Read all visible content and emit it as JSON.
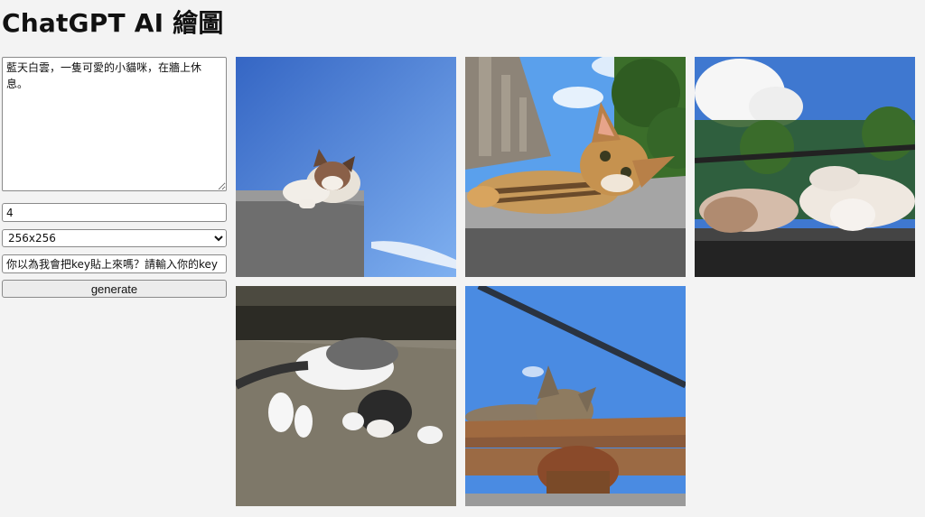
{
  "page": {
    "title": "ChatGPT AI 繪圖"
  },
  "form": {
    "prompt_value": "藍天白雲，一隻可愛的小貓咪，在牆上休息。",
    "count_value": "4",
    "size_selected": "256x256",
    "key_value": "你以為我會把key貼上來嗎？請輸入你的key",
    "generate_label": "generate"
  },
  "images": [
    {
      "name": "generated-image-1",
      "subject": "kitten on wall under blue sky"
    },
    {
      "name": "generated-image-2",
      "subject": "tabby cat lying on ledge with balustrade"
    },
    {
      "name": "generated-image-3",
      "subject": "cat lying on rail with clouds"
    },
    {
      "name": "generated-image-4",
      "subject": "black and white cat on concrete"
    },
    {
      "name": "generated-image-5",
      "subject": "tabby cat on rusty pipe under sky"
    }
  ]
}
